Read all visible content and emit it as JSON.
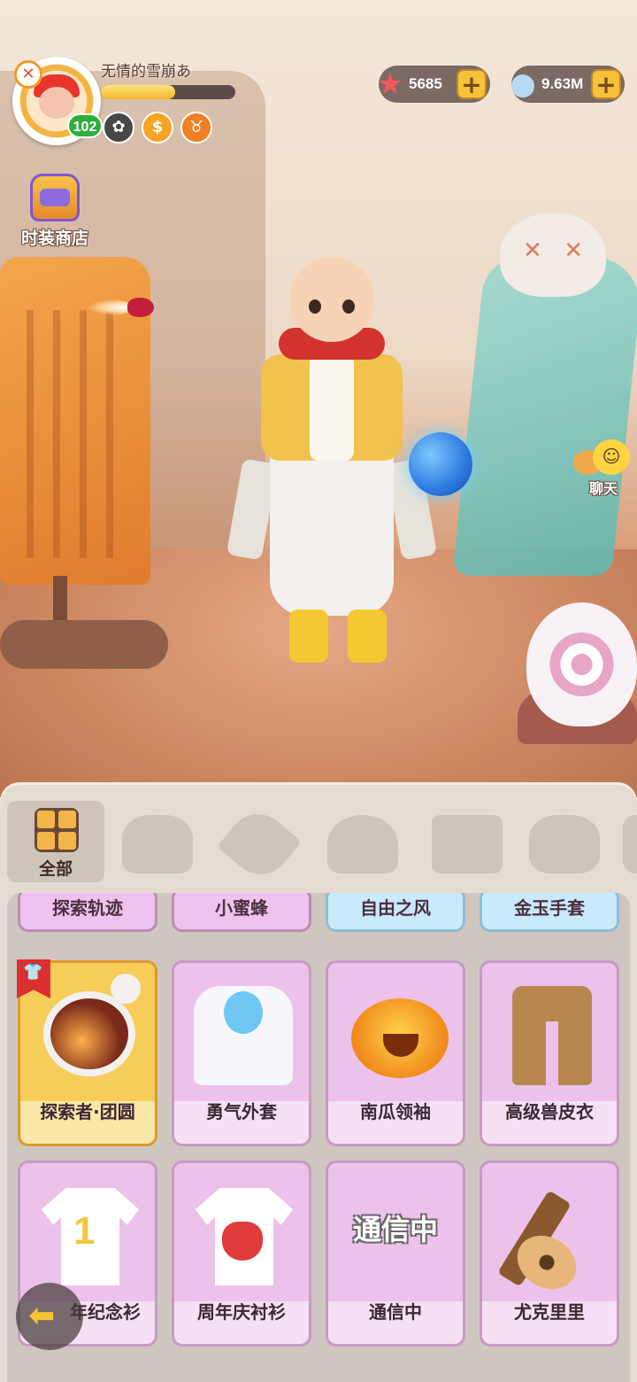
{
  "player": {
    "name": "无情的雪崩あ",
    "level": "102",
    "xp_fraction": 0.55
  },
  "currencies": [
    {
      "icon": "starfish-icon",
      "value": "5685"
    },
    {
      "icon": "gem-icon",
      "value": "9.63M"
    }
  ],
  "shop": {
    "label": "时装商店"
  },
  "chat": {
    "label": "聊天"
  },
  "categories": {
    "active_label": "全部"
  },
  "top_row": [
    {
      "label": "探索轨迹",
      "color": "#f0c2ee"
    },
    {
      "label": "小蜜蜂",
      "color": "#f0c2ee"
    },
    {
      "label": "自由之风",
      "color": "#c8eafa"
    },
    {
      "label": "金玉手套",
      "color": "#c8eafa"
    }
  ],
  "items": [
    {
      "label": "探索者·团圆",
      "rarity": "gold",
      "icon": "helmet-icon",
      "tag": "shirt-tag"
    },
    {
      "label": "勇气外套",
      "rarity": "purple",
      "icon": "jacket-icon"
    },
    {
      "label": "南瓜领袖",
      "rarity": "purple",
      "icon": "pumpkin-icon"
    },
    {
      "label": "高级兽皮衣",
      "rarity": "purple",
      "icon": "fur-pants-icon"
    },
    {
      "label": "年纪念衫",
      "rarity": "purple",
      "icon": "tshirt-icon",
      "print": "1"
    },
    {
      "label": "周年庆衬衫",
      "rarity": "purple",
      "icon": "tshirt-icon"
    },
    {
      "label": "通信中",
      "rarity": "purple",
      "icon": "connecting-text",
      "overlay": "通信中"
    },
    {
      "label": "尤克里里",
      "rarity": "purple",
      "icon": "ukulele-icon"
    }
  ]
}
